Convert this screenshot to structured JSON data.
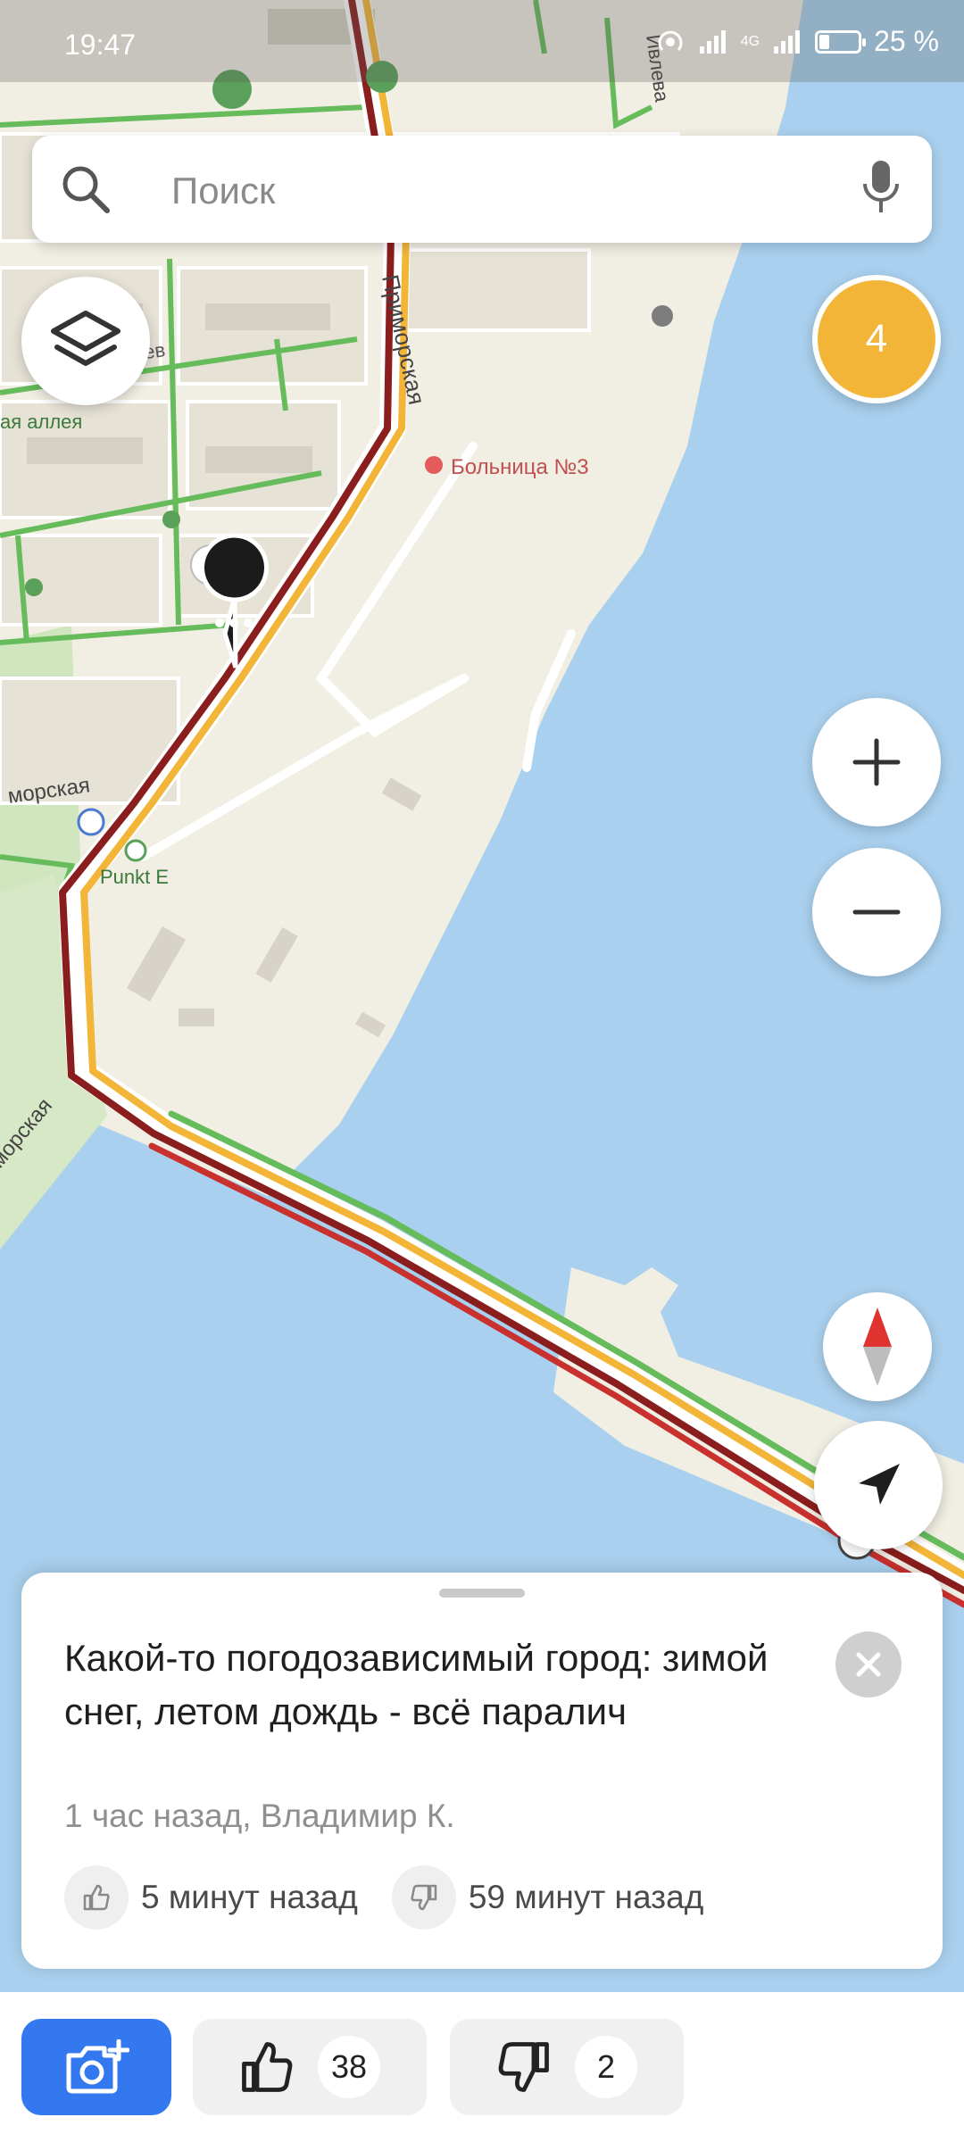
{
  "status_bar": {
    "time": "19:47",
    "network": "4G",
    "battery_percent": 25,
    "battery_label": "25 %"
  },
  "search": {
    "placeholder": "Поиск",
    "icon": "search-icon",
    "mic_icon": "microphone-icon"
  },
  "map": {
    "labels": {
      "street_primorskaya": "Приморская",
      "street_primorskaya_2": "морская",
      "street_primorskaya_3": "морская",
      "hospital": "Больница №3",
      "alley": "ая аллея",
      "street_tsev": "цев",
      "street_ivleva": "Ивлева",
      "punkt": "Punkt E"
    },
    "colors": {
      "water": "#a9d0ee",
      "land": "#f1eee3",
      "block": "#e6e2d6",
      "park": "#cfe6bf",
      "traffic_red": "#c8312e",
      "traffic_dark": "#8a1d1d",
      "traffic_yellow": "#f3b538",
      "traffic_green": "#66bb5a"
    }
  },
  "controls": {
    "layers_icon": "layers-icon",
    "events_count": "4",
    "zoom_in_icon": "plus-icon",
    "zoom_out_icon": "minus-icon",
    "compass_icon": "compass-icon",
    "locate_icon": "navigation-arrow-icon"
  },
  "event_card": {
    "message": "Какой-то погодозависимый город: зимой снег, летом дождь - всё паралич",
    "meta": "1 час назад, Владимир К.",
    "like_time": "5 минут назад",
    "dislike_time": "59 минут назад"
  },
  "actions": {
    "likes": "38",
    "dislikes": "2",
    "accent": "#3478f0"
  }
}
